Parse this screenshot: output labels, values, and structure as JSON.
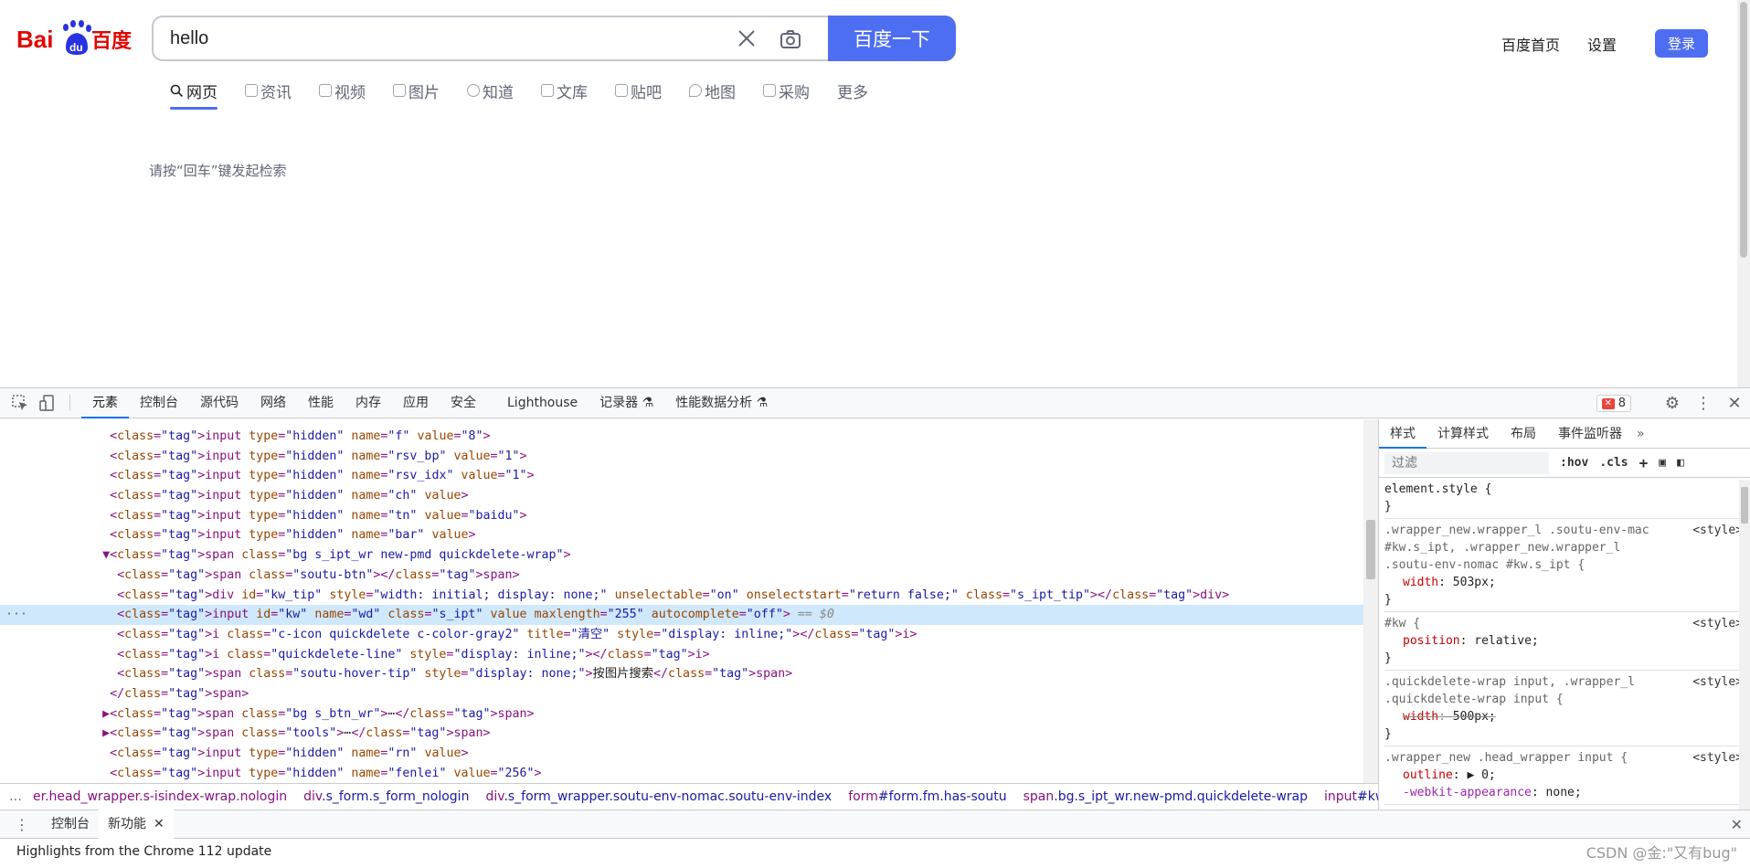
{
  "baidu": {
    "logo_text": "Bai百度",
    "search": {
      "value": "hello"
    },
    "search_button": "百度一下",
    "top_links": [
      "百度首页",
      "设置"
    ],
    "login_button": "登录",
    "tabs": [
      {
        "label": "网页",
        "active": true
      },
      {
        "label": "资讯"
      },
      {
        "label": "视频"
      },
      {
        "label": "图片"
      },
      {
        "label": "知道"
      },
      {
        "label": "文库"
      },
      {
        "label": "贴吧"
      },
      {
        "label": "地图"
      },
      {
        "label": "采购"
      },
      {
        "label": "更多"
      }
    ],
    "hint": "请按“回车”键发起检索"
  },
  "devtools": {
    "tabs": [
      "元素",
      "控制台",
      "源代码",
      "网络",
      "性能",
      "内存",
      "应用",
      "安全",
      "Lighthouse",
      "记录器 ⚗",
      "性能数据分析 ⚗"
    ],
    "error_count": "8",
    "elements_lines": [
      {
        "indent": 9,
        "html": "<input type=\"hidden\" name=\"f\" value=\"8\">"
      },
      {
        "indent": 9,
        "html": "<input type=\"hidden\" name=\"rsv_bp\" value=\"1\">"
      },
      {
        "indent": 9,
        "html": "<input type=\"hidden\" name=\"rsv_idx\" value=\"1\">"
      },
      {
        "indent": 9,
        "html": "<input type=\"hidden\" name=\"ch\" value>"
      },
      {
        "indent": 9,
        "html": "<input type=\"hidden\" name=\"tn\" value=\"baidu\">"
      },
      {
        "indent": 9,
        "html": "<input type=\"hidden\" name=\"bar\" value>"
      },
      {
        "indent": 8,
        "html": "▼<span class=\"bg s_ipt_wr new-pmd quickdelete-wrap\">"
      },
      {
        "indent": 10,
        "html": "<span class=\"soutu-btn\"></span>"
      },
      {
        "indent": 10,
        "html": "<div id=\"kw_tip\" style=\"width: initial; display: none;\" unselectable=\"on\" onselectstart=\"return false;\" class=\"s_ipt_tip\"></div>"
      },
      {
        "indent": 10,
        "html": "<input id=\"kw\" name=\"wd\" class=\"s_ipt\" value maxlength=\"255\" autocomplete=\"off\">",
        "selected": true,
        "suffix": " == $0"
      },
      {
        "indent": 10,
        "html": "<i class=\"c-icon quickdelete c-color-gray2\" title=\"清空\" style=\"display: inline;\">\u0000</i>"
      },
      {
        "indent": 10,
        "html": "<i class=\"quickdelete-line\" style=\"display: inline;\"></i>"
      },
      {
        "indent": 10,
        "html": "<span class=\"soutu-hover-tip\" style=\"display: none;\">按图片搜索</span>"
      },
      {
        "indent": 9,
        "html": "</span>"
      },
      {
        "indent": 8,
        "html": "▶<span class=\"bg s_btn_wr\">⋯</span>"
      },
      {
        "indent": 8,
        "html": "▶<span class=\"tools\">⋯</span>"
      },
      {
        "indent": 9,
        "html": "<input type=\"hidden\" name=\"rn\" value>"
      },
      {
        "indent": 9,
        "html": "<input type=\"hidden\" name=\"fenlei\" value=\"256\">"
      }
    ],
    "breadcrumbs": [
      {
        "tag": "er.head_wrapper.s-isindex-wrap.nologin"
      },
      {
        "tag": "div",
        "cls": ".s_form.s_form_nologin"
      },
      {
        "tag": "div",
        "cls": ".s_form_wrapper.soutu-env-nomac.soutu-env-index"
      },
      {
        "tag": "form",
        "cls": "#form.fm.has-soutu"
      },
      {
        "tag": "span",
        "cls": ".bg.s_ipt_wr.new-pmd.quickdelete-wrap"
      },
      {
        "tag": "input",
        "cls": "#kw.s_ipt"
      }
    ],
    "styles_tabs": [
      "样式",
      "计算样式",
      "布局",
      "事件监听器"
    ],
    "filter_placeholder": "过滤",
    "hov": ":hov",
    "cls": ".cls",
    "rules": [
      {
        "selector": "element.style {",
        "props": [],
        "close": "}"
      },
      {
        "selector": ".wrapper_new.wrapper_l .soutu-env-mac #kw.s_ipt, .wrapper_new.wrapper_l .soutu-env-nomac #kw.s_ipt {",
        "origin": "<style>",
        "props": [
          {
            "name": "width",
            "value": "503px;"
          }
        ],
        "close": "}"
      },
      {
        "selector": "#kw {",
        "origin": "<style>",
        "props": [
          {
            "name": "position",
            "value": "relative;"
          }
        ],
        "close": "}"
      },
      {
        "selector": ".quickdelete-wrap input, .wrapper_l .quickdelete-wrap input {",
        "origin": "<style>",
        "props": [
          {
            "name": "width",
            "value": "500px;",
            "struck": true
          }
        ],
        "close": "}"
      },
      {
        "selector": ".wrapper_new .head_wrapper input {",
        "origin": "<style>",
        "props": [
          {
            "name": "outline",
            "value": "▶ 0;"
          },
          {
            "name": "-webkit-appearance",
            "value": "none;",
            "purple": true
          }
        ],
        "close": ""
      }
    ],
    "drawer_tabs": [
      "控制台",
      "新功能"
    ],
    "drawer_content": "Highlights from the Chrome 112 update",
    "watermark": "CSDN @金:\"又有bug\""
  }
}
